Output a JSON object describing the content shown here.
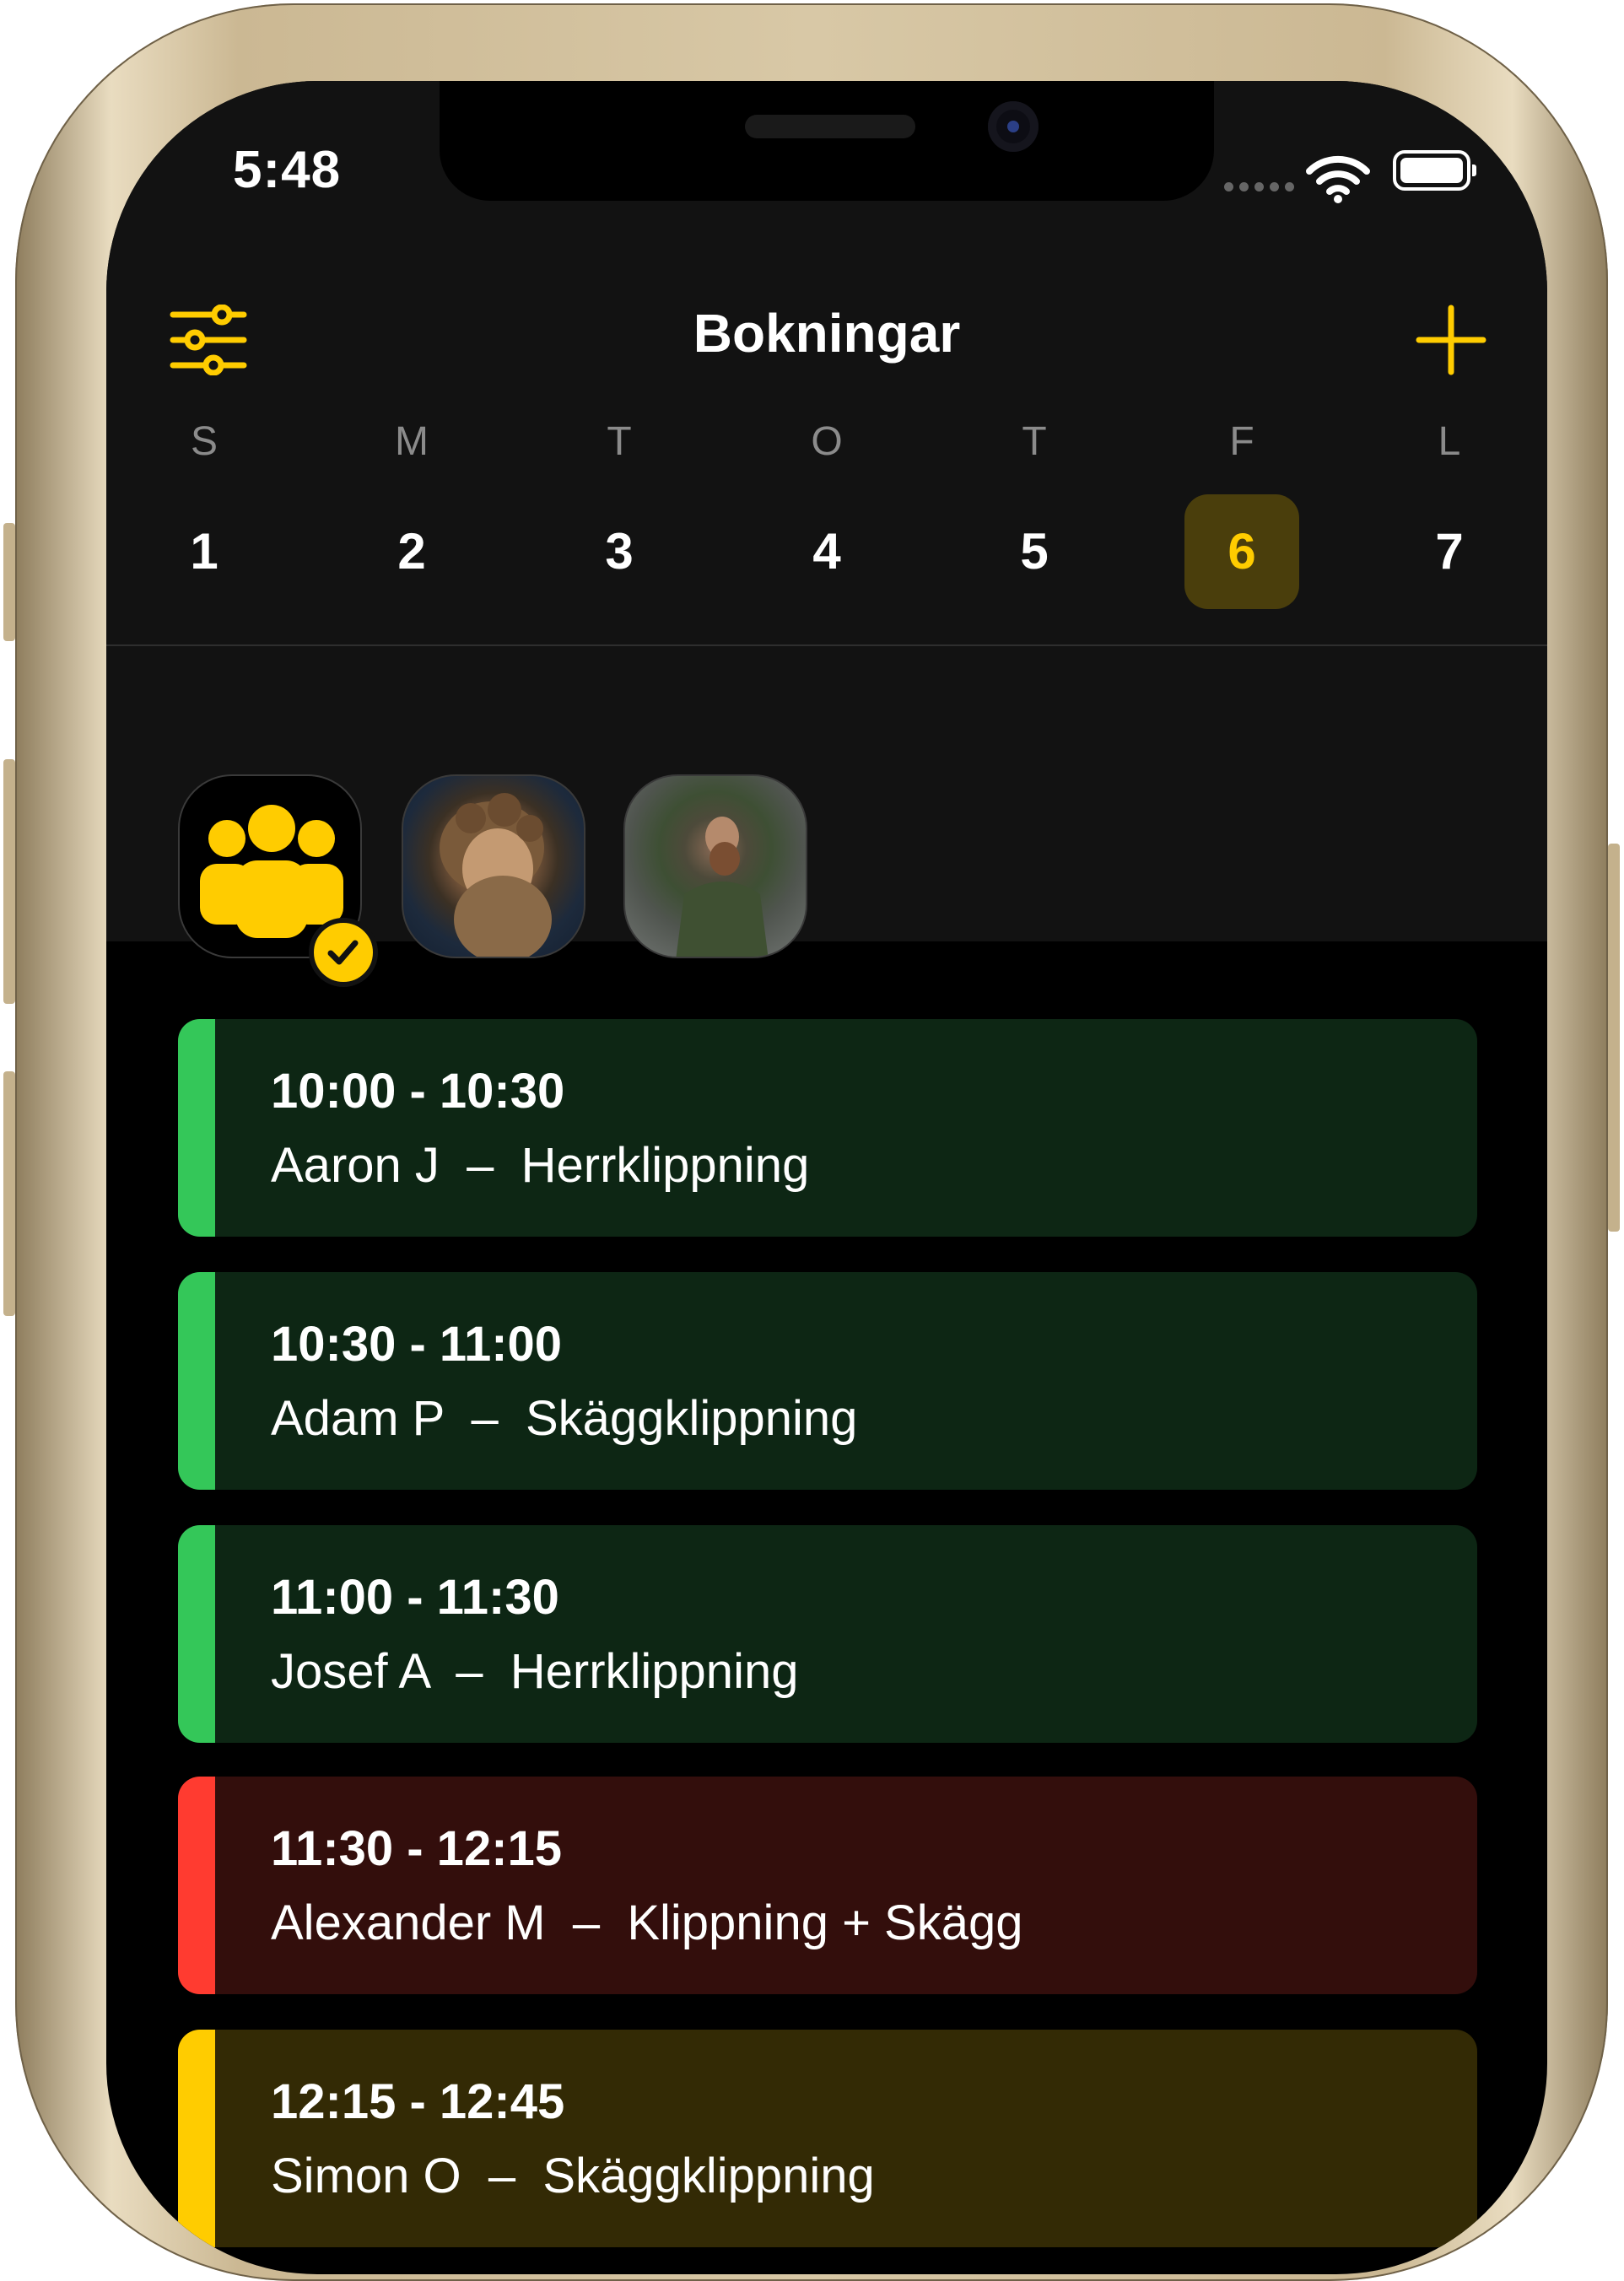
{
  "status_bar": {
    "time": "5:48"
  },
  "header": {
    "title": "Bokningar",
    "filter_icon": "sliders-icon",
    "add_icon": "plus-icon"
  },
  "calendar": {
    "weekdays": [
      "S",
      "M",
      "T",
      "O",
      "T",
      "F",
      "L"
    ],
    "days": [
      "1",
      "2",
      "3",
      "4",
      "5",
      "6",
      "7"
    ],
    "selected_day": "6"
  },
  "staff": [
    {
      "name": "all-staff",
      "icon": "group-icon",
      "selected": true
    },
    {
      "name": "barber-1"
    },
    {
      "name": "barber-2"
    }
  ],
  "colors": {
    "accent": "#ffcc00",
    "green_bar": "#34c759",
    "green_bg": "#0d2614",
    "red_bar": "#ff3b30",
    "red_bg": "#330e0c",
    "yellow_bar": "#ffcc00",
    "yellow_bg": "#332a05"
  },
  "bookings": [
    {
      "time": "10:00 - 10:30",
      "client": "Aaron J",
      "service": "Herrklippning",
      "status": "green"
    },
    {
      "time": "10:30 - 11:00",
      "client": "Adam P",
      "service": "Skäggklippning",
      "status": "green"
    },
    {
      "time": "11:00 - 11:30",
      "client": "Josef A",
      "service": "Herrklippning",
      "status": "green"
    },
    {
      "time": "11:30 - 12:15",
      "client": "Alexander M",
      "service": "Klippning + Skägg",
      "status": "red"
    },
    {
      "time": "12:15 - 12:45",
      "client": "Simon O",
      "service": "Skäggklippning",
      "status": "yellow"
    }
  ]
}
